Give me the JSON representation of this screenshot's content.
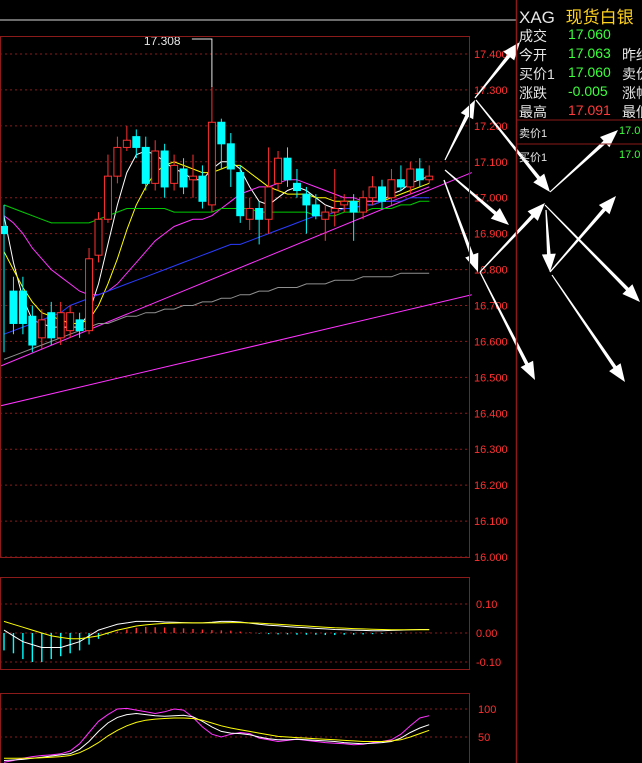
{
  "instrument": {
    "code": "XAG",
    "name": "现货白银"
  },
  "quote": {
    "rows": [
      {
        "label": "成交",
        "value": "17.060",
        "color": "green",
        "tail": ""
      },
      {
        "label": "今开",
        "value": "17.063",
        "color": "green",
        "tail": "昨结"
      },
      {
        "label": "买价1",
        "value": "17.060",
        "color": "green",
        "tail": "卖价"
      },
      {
        "label": "涨跌",
        "value": "-0.005",
        "color": "green",
        "tail": "涨幅"
      },
      {
        "label": "最高",
        "value": "17.091",
        "color": "red",
        "tail": "最低"
      }
    ],
    "book": [
      {
        "label": "卖价1",
        "value": "17.0"
      },
      {
        "label": "买价1",
        "value": "17.0"
      }
    ]
  },
  "colors": {
    "up": "#ff3030",
    "down": "#00ffff",
    "grid": "#8b1a1a",
    "axis": "#ff3030",
    "arrow": "#ffffff"
  },
  "chart_data": [
    {
      "type": "candlestick",
      "title": "",
      "ylim": [
        16.0,
        17.45
      ],
      "y_ticks": [
        "17.400",
        "17.300",
        "17.200",
        "17.100",
        "17.000",
        "16.900",
        "16.800",
        "16.700",
        "16.600",
        "16.500",
        "16.400",
        "16.300",
        "16.200",
        "16.100",
        "16.000"
      ],
      "annotation": {
        "text": "17.308",
        "value": 17.308
      },
      "candles": [
        [
          16.92,
          16.9,
          16.57,
          16.98
        ],
        [
          16.74,
          16.65,
          16.62,
          16.78
        ],
        [
          16.74,
          16.65,
          16.62,
          16.78
        ],
        [
          16.67,
          16.59,
          16.57,
          16.7
        ],
        [
          16.61,
          16.66,
          16.58,
          16.69
        ],
        [
          16.68,
          16.61,
          16.59,
          16.71
        ],
        [
          16.61,
          16.68,
          16.59,
          16.71
        ],
        [
          16.63,
          16.68,
          16.61,
          16.7
        ],
        [
          16.66,
          16.63,
          16.61,
          16.68
        ],
        [
          16.63,
          16.83,
          16.62,
          16.86
        ],
        [
          16.84,
          16.94,
          16.82,
          16.96
        ],
        [
          16.94,
          17.06,
          16.93,
          17.12
        ],
        [
          17.06,
          17.14,
          17.04,
          17.17
        ],
        [
          17.14,
          17.16,
          17.13,
          17.2
        ],
        [
          17.17,
          17.14,
          17.11,
          17.19
        ],
        [
          17.14,
          17.04,
          17.02,
          17.17
        ],
        [
          17.04,
          17.13,
          17.02,
          17.16
        ],
        [
          17.13,
          17.03,
          17.0,
          17.15
        ],
        [
          17.04,
          17.09,
          17.02,
          17.12
        ],
        [
          17.08,
          17.03,
          17.01,
          17.11
        ],
        [
          17.05,
          17.06,
          17.0,
          17.12
        ],
        [
          17.06,
          16.99,
          16.97,
          17.09
        ],
        [
          16.98,
          17.21,
          16.96,
          17.31
        ],
        [
          17.21,
          17.15,
          17.08,
          17.22
        ],
        [
          17.15,
          17.08,
          17.03,
          17.18
        ],
        [
          17.07,
          16.95,
          16.93,
          17.09
        ],
        [
          16.94,
          16.97,
          16.91,
          17.0
        ],
        [
          16.97,
          16.94,
          16.87,
          16.99
        ],
        [
          16.94,
          17.03,
          16.9,
          17.14
        ],
        [
          17.04,
          17.11,
          17.02,
          17.13
        ],
        [
          17.11,
          17.05,
          17.03,
          17.14
        ],
        [
          17.04,
          17.02,
          17.0,
          17.08
        ],
        [
          17.01,
          16.98,
          16.9,
          17.03
        ],
        [
          16.98,
          16.95,
          16.94,
          17.01
        ],
        [
          16.94,
          16.96,
          16.88,
          16.98
        ],
        [
          16.96,
          16.97,
          16.92,
          17.08
        ],
        [
          16.98,
          16.99,
          16.96,
          17.01
        ],
        [
          16.99,
          16.96,
          16.88,
          17.01
        ],
        [
          16.96,
          17.0,
          16.94,
          17.02
        ],
        [
          17.0,
          17.03,
          16.98,
          17.06
        ],
        [
          17.03,
          16.99,
          16.97,
          17.05
        ],
        [
          17.0,
          17.05,
          16.98,
          17.08
        ],
        [
          17.05,
          17.03,
          17.02,
          17.09
        ],
        [
          17.03,
          17.08,
          17.01,
          17.1
        ],
        [
          17.08,
          17.05,
          17.03,
          17.11
        ],
        [
          17.05,
          17.06,
          17.04,
          17.09
        ]
      ],
      "ma_lines": [
        {
          "color": "#ffffff",
          "values": [
            16.95,
            16.82,
            16.72,
            16.66,
            16.65,
            16.64,
            16.64,
            16.64,
            16.64,
            16.68,
            16.76,
            16.87,
            16.98,
            17.07,
            17.12,
            17.13,
            17.12,
            17.1,
            17.08,
            17.07,
            17.05,
            17.05,
            17.08,
            17.1,
            17.1,
            17.08,
            17.03,
            16.99,
            16.98,
            17.0,
            17.02,
            17.03,
            17.02,
            17.0,
            16.98,
            16.97,
            16.97,
            16.97,
            16.98,
            16.98,
            16.99,
            17.01,
            17.02,
            17.04,
            17.05,
            17.06
          ]
        },
        {
          "color": "#ffff00",
          "values": [
            16.85,
            16.8,
            16.75,
            16.71,
            16.68,
            16.67,
            16.66,
            16.65,
            16.65,
            16.66,
            16.7,
            16.76,
            16.83,
            16.91,
            16.98,
            17.03,
            17.07,
            17.09,
            17.1,
            17.09,
            17.08,
            17.07,
            17.07,
            17.08,
            17.09,
            17.09,
            17.07,
            17.05,
            17.03,
            17.02,
            17.01,
            17.01,
            17.01,
            17.0,
            17.0,
            16.99,
            16.99,
            16.99,
            16.99,
            16.99,
            16.99,
            17.0,
            17.01,
            17.02,
            17.03,
            17.04
          ]
        },
        {
          "color": "#ff33ff",
          "values": [
            16.95,
            16.93,
            16.9,
            16.86,
            16.83,
            16.8,
            16.78,
            16.76,
            16.74,
            16.73,
            16.73,
            16.74,
            16.76,
            16.79,
            16.82,
            16.85,
            16.88,
            16.9,
            16.92,
            16.93,
            16.94,
            16.94,
            16.95,
            16.97,
            16.99,
            17.01,
            17.02,
            17.03,
            17.03,
            17.04,
            17.05,
            17.05,
            17.04,
            17.03,
            17.02,
            17.01,
            17.0,
            17.0,
            16.99,
            16.99,
            16.99,
            16.99,
            17.0,
            17.01,
            17.02,
            17.03
          ]
        },
        {
          "color": "#00cc00",
          "values": [
            16.98,
            16.97,
            16.96,
            16.95,
            16.94,
            16.93,
            16.93,
            16.93,
            16.93,
            16.93,
            16.94,
            16.95,
            16.96,
            16.97,
            16.97,
            16.97,
            16.97,
            16.97,
            16.96,
            16.96,
            16.96,
            16.96,
            16.96,
            16.97,
            16.97,
            16.97,
            16.97,
            16.96,
            16.96,
            16.96,
            16.96,
            16.96,
            16.96,
            16.95,
            16.95,
            16.95,
            16.96,
            16.96,
            16.96,
            16.97,
            16.97,
            16.97,
            16.98,
            16.98,
            16.99,
            16.99
          ]
        },
        {
          "color": "#2a3cff",
          "values": [
            16.62,
            16.63,
            16.64,
            16.65,
            16.66,
            16.67,
            16.68,
            16.7,
            16.71,
            16.72,
            16.73,
            16.74,
            16.75,
            16.76,
            16.77,
            16.78,
            16.79,
            16.8,
            16.81,
            16.82,
            16.83,
            16.84,
            16.85,
            16.86,
            16.87,
            16.87,
            16.88,
            16.89,
            16.9,
            16.91,
            16.92,
            16.93,
            16.94,
            16.95,
            16.95,
            16.96,
            16.97,
            16.97,
            16.98,
            16.98,
            16.99,
            16.99,
            16.99,
            17.0,
            17.0,
            17.0
          ]
        },
        {
          "color": "#909090",
          "values": [
            16.55,
            16.56,
            16.57,
            16.58,
            16.59,
            16.6,
            16.61,
            16.62,
            16.63,
            16.64,
            16.65,
            16.65,
            16.66,
            16.67,
            16.67,
            16.68,
            16.68,
            16.69,
            16.69,
            16.7,
            16.7,
            16.71,
            16.71,
            16.72,
            16.72,
            16.73,
            16.73,
            16.74,
            16.74,
            16.75,
            16.75,
            16.75,
            16.76,
            16.76,
            16.76,
            16.77,
            16.77,
            16.77,
            16.78,
            16.78,
            16.78,
            16.78,
            16.79,
            16.79,
            16.79,
            16.79
          ]
        }
      ],
      "trendlines": [
        {
          "color": "#ff33ff",
          "from": [
            -0.5,
            16.42
          ],
          "to": [
            49.5,
            16.73
          ]
        },
        {
          "color": "#ff33ff",
          "from": [
            -0.5,
            16.53
          ],
          "to": [
            49.5,
            17.07
          ]
        }
      ]
    },
    {
      "type": "bar+line",
      "ylim": [
        -0.11,
        0.11
      ],
      "y_ticks": [
        "0.10",
        "0.00",
        "-0.10"
      ],
      "bars": [
        -0.06,
        -0.07,
        -0.09,
        -0.1,
        -0.1,
        -0.09,
        -0.08,
        -0.07,
        -0.06,
        -0.04,
        -0.02,
        -0.005,
        0.005,
        0.012,
        0.018,
        0.021,
        0.02,
        0.019,
        0.018,
        0.016,
        0.014,
        0.012,
        0.01,
        0.009,
        0.008,
        0.005,
        0.002,
        -0.002,
        -0.004,
        -0.005,
        -0.005,
        -0.006,
        -0.006,
        -0.006,
        -0.007,
        -0.007,
        -0.006,
        -0.006,
        -0.005,
        -0.004,
        -0.003,
        -0.002,
        -0.001,
        0.0,
        0.001,
        0.001
      ],
      "lines": [
        {
          "color": "#ffffff",
          "values": [
            0.01,
            -0.01,
            -0.03,
            -0.04,
            -0.05,
            -0.05,
            -0.05,
            -0.04,
            -0.03,
            -0.01,
            0.01,
            0.02,
            0.03,
            0.035,
            0.04,
            0.04,
            0.04,
            0.038,
            0.037,
            0.036,
            0.035,
            0.035,
            0.037,
            0.04,
            0.04,
            0.038,
            0.034,
            0.03,
            0.027,
            0.025,
            0.022,
            0.02,
            0.018,
            0.016,
            0.014,
            0.012,
            0.011,
            0.01,
            0.009,
            0.008,
            0.008,
            0.009,
            0.01,
            0.011,
            0.012,
            0.012
          ]
        },
        {
          "color": "#ffff00",
          "values": [
            0.04,
            0.03,
            0.02,
            0.01,
            0.0,
            -0.01,
            -0.015,
            -0.02,
            -0.02,
            -0.015,
            -0.01,
            0.0,
            0.01,
            0.017,
            0.024,
            0.028,
            0.031,
            0.033,
            0.034,
            0.035,
            0.035,
            0.035,
            0.035,
            0.035,
            0.036,
            0.036,
            0.035,
            0.034,
            0.032,
            0.03,
            0.028,
            0.026,
            0.024,
            0.022,
            0.02,
            0.018,
            0.017,
            0.015,
            0.014,
            0.013,
            0.012,
            0.011,
            0.011,
            0.011,
            0.011,
            0.011
          ]
        }
      ]
    },
    {
      "type": "line",
      "ylim": [
        20,
        110
      ],
      "y_ticks": [
        "100",
        "50"
      ],
      "lines": [
        {
          "color": "#ff33ff",
          "values": [
            5,
            8,
            12,
            15,
            17,
            18,
            20,
            25,
            38,
            58,
            78,
            90,
            100,
            101,
            98,
            95,
            92,
            95,
            100,
            98,
            85,
            68,
            55,
            50,
            55,
            58,
            56,
            48,
            45,
            42,
            44,
            46,
            44,
            42,
            40,
            39,
            38,
            36,
            37,
            40,
            42,
            45,
            55,
            70,
            84,
            88
          ]
        },
        {
          "color": "#ffffff",
          "values": [
            8,
            9,
            10,
            12,
            14,
            16,
            18,
            20,
            28,
            42,
            60,
            75,
            85,
            90,
            92,
            90,
            88,
            87,
            88,
            89,
            86,
            78,
            68,
            60,
            57,
            56,
            54,
            50,
            47,
            45,
            45,
            46,
            45,
            44,
            43,
            42,
            40,
            39,
            38,
            39,
            40,
            42,
            48,
            58,
            66,
            72
          ]
        },
        {
          "color": "#ffff00",
          "values": [
            12,
            12,
            12,
            12,
            13,
            14,
            15,
            17,
            22,
            30,
            40,
            52,
            62,
            70,
            76,
            80,
            82,
            83,
            84,
            84,
            83,
            80,
            75,
            70,
            66,
            63,
            60,
            57,
            54,
            51,
            50,
            49,
            48,
            47,
            46,
            45,
            44,
            43,
            42,
            42,
            42,
            43,
            45,
            50,
            56,
            62
          ]
        }
      ]
    }
  ]
}
